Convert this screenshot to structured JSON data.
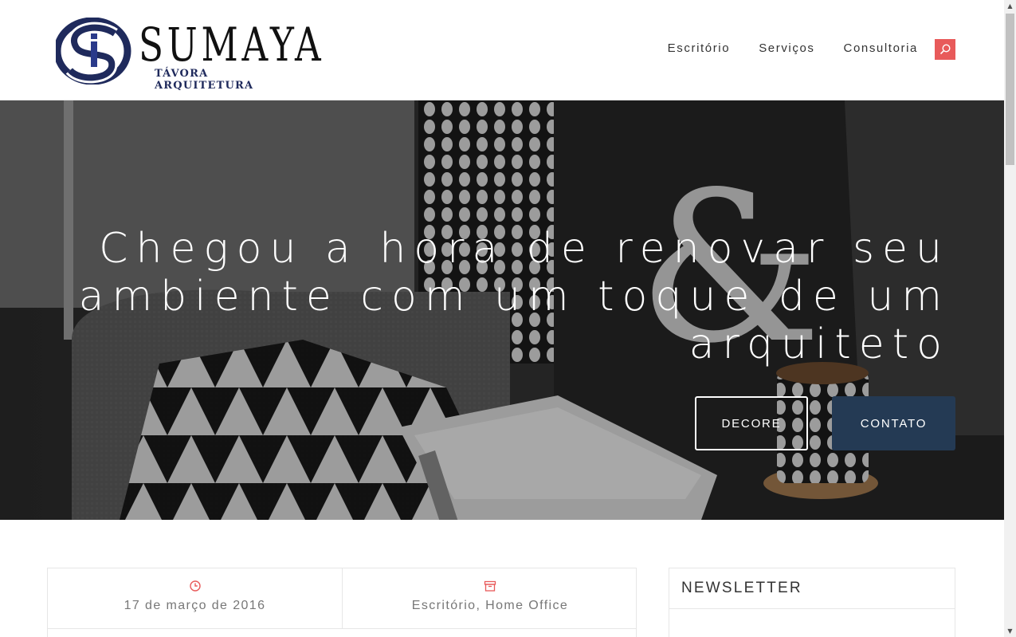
{
  "brand": {
    "name": "SUMAYA",
    "tagline": "TÁVORA ARQUITETURA",
    "colors": {
      "logo_navy": "#1f2a5c",
      "accent_red": "#e85a5a",
      "button_navy": "#243a54"
    }
  },
  "nav": {
    "items": [
      {
        "label": "Escritório"
      },
      {
        "label": "Serviços"
      },
      {
        "label": "Consultoria"
      }
    ],
    "search_icon": "search-icon"
  },
  "hero": {
    "title": "Chegou a hora de renovar seu ambiente com um toque de um arquiteto",
    "buttons": {
      "decore_label": "DECORE",
      "contato_label": "CONTATO"
    }
  },
  "post_meta": {
    "date": "17 de março de 2016",
    "date_icon": "clock-icon",
    "categories": "Escritório, Home Office",
    "categories_icon": "archive-icon"
  },
  "sidebar": {
    "widget_title": "NEWSLETTER"
  }
}
